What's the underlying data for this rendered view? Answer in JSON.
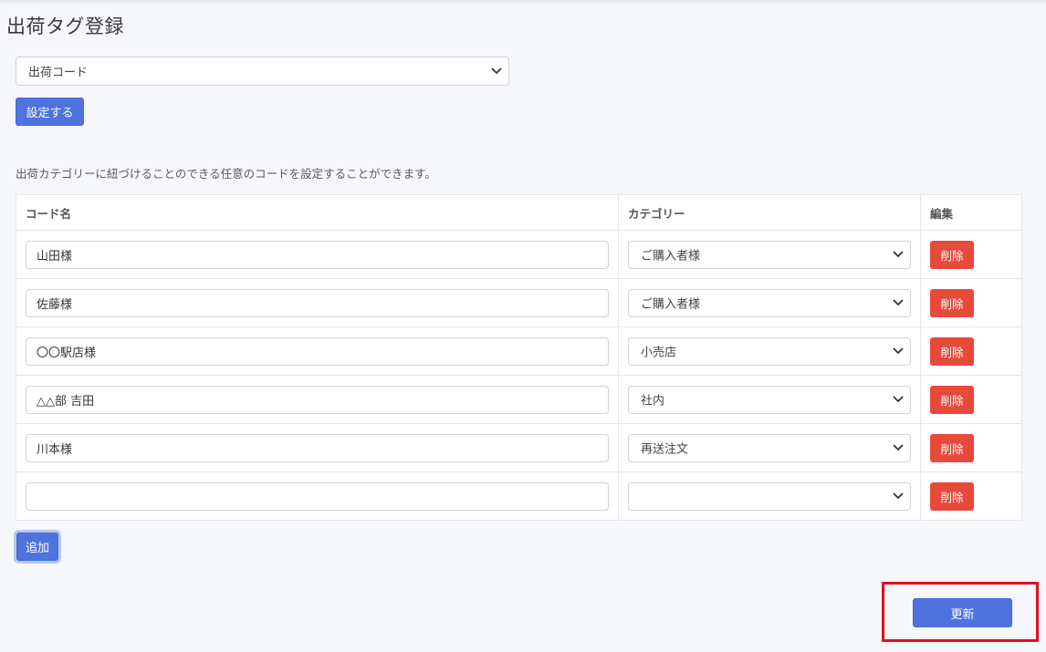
{
  "page": {
    "title": "出荷タグ登録"
  },
  "tag_select": {
    "selected": "出荷コード"
  },
  "set_button": {
    "label": "設定する"
  },
  "description": "出荷カテゴリーに紐づけることのできる任意のコードを設定することができます。",
  "table": {
    "headers": {
      "code_name": "コード名",
      "category": "カテゴリー",
      "edit": "編集"
    },
    "rows": [
      {
        "code_name": "山田様",
        "category": "ご購入者様",
        "delete_label": "削除"
      },
      {
        "code_name": "佐藤様",
        "category": "ご購入者様",
        "delete_label": "削除"
      },
      {
        "code_name": "〇〇駅店様",
        "category": "小売店",
        "delete_label": "削除"
      },
      {
        "code_name": "△△部 吉田",
        "category": "社内",
        "delete_label": "削除"
      },
      {
        "code_name": "川本様",
        "category": "再送注文",
        "delete_label": "削除"
      },
      {
        "code_name": "",
        "category": "",
        "delete_label": "削除"
      }
    ]
  },
  "add_button": {
    "label": "追加"
  },
  "update_button": {
    "label": "更新"
  },
  "colors": {
    "primary": "#4e73df",
    "danger": "#e74a3b",
    "highlight": "#e0101e",
    "background": "#f6f7fb"
  },
  "icons": {
    "select_chevron": "chevron-down-icon"
  }
}
